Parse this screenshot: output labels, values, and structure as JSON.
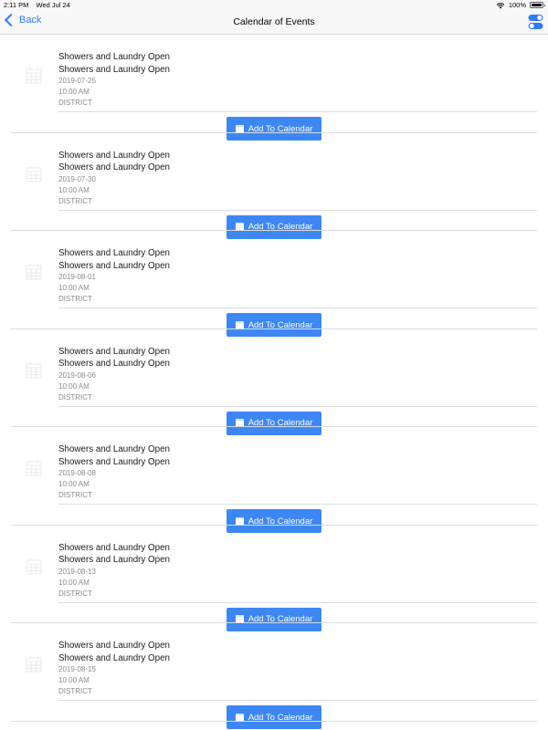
{
  "status_bar": {
    "time": "2:11 PM",
    "date": "Wed Jul 24",
    "battery": "100%"
  },
  "nav": {
    "back_label": "Back",
    "title": "Calendar of Events"
  },
  "events": [
    {
      "title": "Showers and Laundry Open",
      "subtitle": "Showers and Laundry Open",
      "date": "2019-07-25",
      "time": "10:00 AM",
      "location": "DISTRICT",
      "button": "Add To Calendar"
    },
    {
      "title": "Showers and Laundry Open",
      "subtitle": "Showers and Laundry Open",
      "date": "2019-07-30",
      "time": "10:00 AM",
      "location": "DISTRICT",
      "button": "Add To Calendar"
    },
    {
      "title": "Showers and Laundry Open",
      "subtitle": "Showers and Laundry Open",
      "date": "2019-08-01",
      "time": "10:00 AM",
      "location": "DISTRICT",
      "button": "Add To Calendar"
    },
    {
      "title": "Showers and Laundry Open",
      "subtitle": "Showers and Laundry Open",
      "date": "2019-08-06",
      "time": "10:00 AM",
      "location": "DISTRICT",
      "button": "Add To Calendar"
    },
    {
      "title": "Showers and Laundry Open",
      "subtitle": "Showers and Laundry Open",
      "date": "2019-08-08",
      "time": "10:00 AM",
      "location": "DISTRICT",
      "button": "Add To Calendar"
    },
    {
      "title": "Showers and Laundry Open",
      "subtitle": "Showers and Laundry Open",
      "date": "2019-08-13",
      "time": "10:00 AM",
      "location": "DISTRICT",
      "button": "Add To Calendar"
    },
    {
      "title": "Showers and Laundry Open",
      "subtitle": "Showers and Laundry Open",
      "date": "2019-08-15",
      "time": "10:00 AM",
      "location": "DISTRICT",
      "button": "Add To Calendar"
    }
  ],
  "icons": {
    "event_icon": "calendar-grid-icon",
    "button_icon": "calendar-icon",
    "settings_icon": "toggle-switches-icon"
  },
  "colors": {
    "accent": "#3d87f5",
    "link": "#2f7cf6"
  }
}
